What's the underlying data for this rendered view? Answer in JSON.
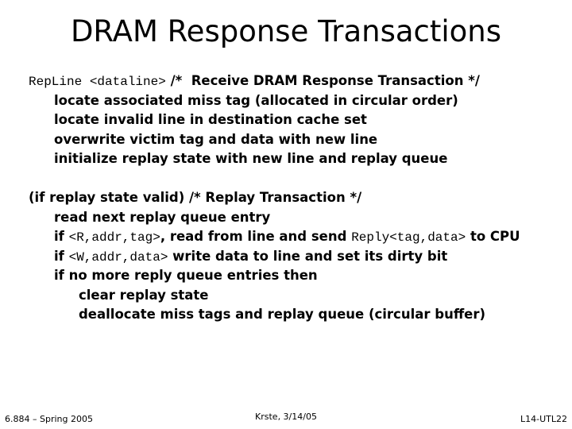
{
  "title": "DRAM Response Transactions",
  "section1": {
    "header_code": "RepLine <dataline>",
    "header_comment": " /*  Receive DRAM Response Transaction */",
    "lines": [
      "locate associated miss tag (allocated in circular order)",
      "locate invalid line in destination cache set",
      "overwrite victim tag and data with new line",
      "initialize replay state with new line and replay queue"
    ]
  },
  "section2": {
    "header": "(if replay state valid) /* Replay Transaction */",
    "line1": "read next replay queue entry",
    "line2_if": "if ",
    "line2_code": "<R,addr,tag>",
    "line2_mid": ", read from line and send ",
    "line2_code2": "Reply<tag,data>",
    "line2_end": " to CPU",
    "line3_if": "if ",
    "line3_code": "<W,addr,data>",
    "line3_end": " write data to line and set its dirty bit",
    "line4": "if no more reply queue entries then",
    "sub_lines": [
      "clear replay state",
      "deallocate miss tags and replay queue (circular buffer)"
    ]
  },
  "footer": {
    "left": "6.884 – Spring 2005",
    "center": "Krste, 3/14/05",
    "right": "L14-UTL22"
  }
}
